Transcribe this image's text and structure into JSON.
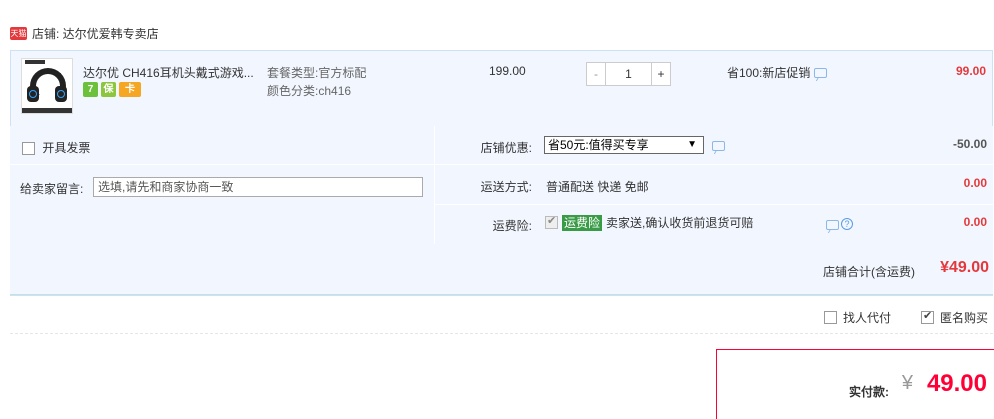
{
  "shop": {
    "badge": "天猫",
    "label": "店铺: 达尔优爱韩专卖店"
  },
  "item": {
    "title": "达尔优 CH416耳机头戴式游戏...",
    "badges": [
      "7",
      "保",
      "卡"
    ],
    "sku_package_label": "套餐类型:",
    "sku_package_value": "官方标配",
    "sku_color_label": "颜色分类:",
    "sku_color_value": "ch416",
    "price": "199.00",
    "qty_minus": "-",
    "qty_value": "1",
    "qty_plus": "+",
    "promo": "省100:新店促销",
    "subtotal": "99.00"
  },
  "options": {
    "invoice_label": "开具发票",
    "note_label": "给卖家留言:",
    "note_placeholder": "选填,请先和商家协商一致",
    "coupon_label": "店铺优惠:",
    "coupon_value": "省50元:值得买专享",
    "coupon_amount": "-50.00",
    "shipping_label": "运送方式:",
    "shipping_value": "普通配送 快递 免邮",
    "shipping_amount": "0.00",
    "insurance_label": "运费险:",
    "insurance_tag": "运费险",
    "insurance_text": "卖家送,确认收货前退货可赔",
    "insurance_amount": "0.00"
  },
  "total": {
    "label": "店铺合计(含运费)",
    "value": "¥49.00"
  },
  "pay": {
    "proxy_label": "找人代付",
    "anon_label": "匿名购买",
    "anon_checked": true
  },
  "final": {
    "label": "实付款:",
    "currency": "¥",
    "value": "49.00"
  },
  "colors": {
    "accent_red": "#ff0036",
    "price_red": "#e4393c",
    "panel_bg": "#f2f7ff",
    "insurance_green": "#3a9b47"
  }
}
